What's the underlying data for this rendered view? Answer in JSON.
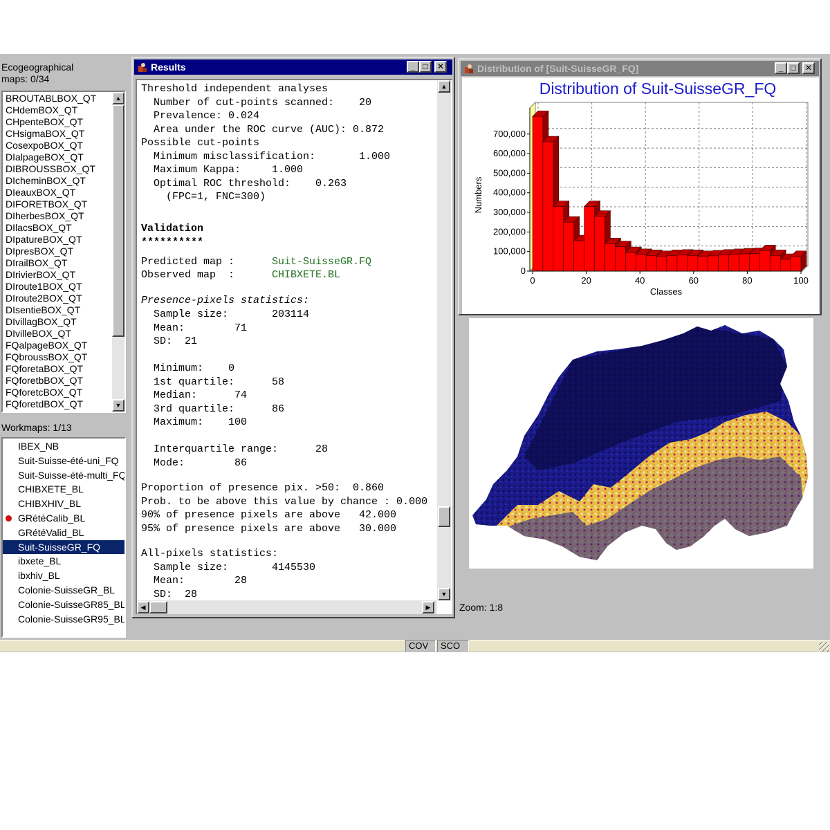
{
  "ecogeo": {
    "label": "Ecogeographical\nmaps: 0/34",
    "items": [
      "BROUTABLBOX_QT",
      "CHdemBOX_QT",
      "CHpenteBOX_QT",
      "CHsigmaBOX_QT",
      "CosexpoBOX_QT",
      "DIalpageBOX_QT",
      "DIBROUSSBOX_QT",
      "DIcheminBOX_QT",
      "DIeauxBOX_QT",
      "DIFORETBOX_QT",
      "DIherbesBOX_QT",
      "DIlacsBOX_QT",
      "DIpatureBOX_QT",
      "DIpresBOX_QT",
      "DIrailBOX_QT",
      "DIrivierBOX_QT",
      "DIroute1BOX_QT",
      "DIroute2BOX_QT",
      "DIsentieBOX_QT",
      "DIvillagBOX_QT",
      "DIvilleBOX_QT",
      "FQalpageBOX_QT",
      "FQbroussBOX_QT",
      "FQforetaBOX_QT",
      "FQforetbBOX_QT",
      "FQforetcBOX_QT",
      "FQforetdBOX_QT"
    ],
    "arrow_up": "▲",
    "arrow_down": "▼"
  },
  "workmaps": {
    "label": "Workmaps: 1/13",
    "items": [
      "IBEX_NB",
      "Suit-Suisse-été-uni_FQ",
      "Suit-Suisse-été-multi_FQ",
      "CHIBXETE_BL",
      "CHIBXHIV_BL",
      "GRétéCalib_BL",
      "GRétéValid_BL",
      "Suit-SuisseGR_FQ",
      "ibxete_BL",
      "ibxhiv_BL",
      "Colonie-SuisseGR_BL",
      "Colonie-SuisseGR85_BL",
      "Colonie-SuisseGR95_BL"
    ],
    "selected_index": 7,
    "marked_index": 5
  },
  "results": {
    "title": "Results",
    "btn_min": "_",
    "btn_max": "□",
    "btn_close": "✕",
    "arrow_up": "▲",
    "arrow_down": "▼",
    "arrow_left": "◀",
    "arrow_right": "▶",
    "lines": [
      {
        "t": "Threshold independent analyses"
      },
      {
        "t": "  Number of cut-points scanned:    20"
      },
      {
        "t": "  Prevalence: 0.024"
      },
      {
        "t": "  Area under the ROC curve (AUC): 0.872"
      },
      {
        "t": "Possible cut-points"
      },
      {
        "t": "  Minimum misclassification:       1.000"
      },
      {
        "t": "  Maximum Kappa:     1.000"
      },
      {
        "t": "  Optimal ROC threshold:    0.263"
      },
      {
        "t": "    (FPC=1, FNC=300)"
      },
      {
        "t": "Validation",
        "s": "bold"
      },
      {
        "t": "**********",
        "s": "bold"
      },
      {
        "t": "Predicted map :      ",
        "g": "Suit-SuisseGR.FQ"
      },
      {
        "t": "Observed map  :      ",
        "g": "CHIBXETE.BL"
      },
      {
        "t": "Presence-pixels statistics:",
        "s": "ital"
      },
      {
        "t": "  Sample size:       203114"
      },
      {
        "t": "  Mean:        71"
      },
      {
        "t": "  SD:  21"
      },
      {
        "t": "  Minimum:    0"
      },
      {
        "t": "  1st quartile:      58"
      },
      {
        "t": "  Median:      74"
      },
      {
        "t": "  3rd quartile:      86"
      },
      {
        "t": "  Maximum:    100"
      },
      {
        "t": "  Interquartile range:      28"
      },
      {
        "t": "  Mode:        86"
      },
      {
        "t": "Proportion of presence pix. >50:  0.860"
      },
      {
        "t": "Prob. to be above this value by chance : 0.000"
      },
      {
        "t": "90% of presence pixels are above   42.000"
      },
      {
        "t": "95% of presence pixels are above   30.000"
      },
      {
        "t": "All-pixels statistics:"
      },
      {
        "t": "  Sample size:       4145530"
      },
      {
        "t": "  Mean:        28"
      },
      {
        "t": "  SD:  28"
      }
    ]
  },
  "distribution": {
    "title": "Distribution of [Suit-SuisseGR_FQ]",
    "btn_min": "_",
    "btn_max": "□",
    "btn_close": "✕"
  },
  "chart_data": {
    "type": "bar",
    "title": "Distribution of Suit-SuisseGR_FQ",
    "xlabel": "Classes",
    "ylabel": "Numbers",
    "x_ticks": [
      "0",
      "20",
      "40",
      "60",
      "80",
      "100"
    ],
    "y_ticks": [
      "0",
      "100,000",
      "200,000",
      "300,000",
      "400,000",
      "500,000",
      "600,000",
      "700,000"
    ],
    "ylim": [
      0,
      800000
    ],
    "xlim": [
      0,
      100
    ],
    "grid": true,
    "style": "3d",
    "bar_color": "#ff0000",
    "classes": [
      0,
      4,
      8,
      12,
      16,
      20,
      24,
      28,
      32,
      36,
      40,
      44,
      48,
      52,
      56,
      60,
      64,
      68,
      72,
      76,
      80,
      84,
      88,
      92,
      96
    ],
    "values": [
      790000,
      660000,
      330000,
      250000,
      155000,
      330000,
      280000,
      140000,
      125000,
      95000,
      85000,
      80000,
      75000,
      80000,
      82000,
      80000,
      75000,
      78000,
      82000,
      85000,
      88000,
      90000,
      105000,
      80000,
      60000,
      75000
    ]
  },
  "map_view": {
    "zoom_text": "Zoom: 1:8"
  },
  "status": {
    "cov": "COV",
    "sco": "SCO"
  }
}
